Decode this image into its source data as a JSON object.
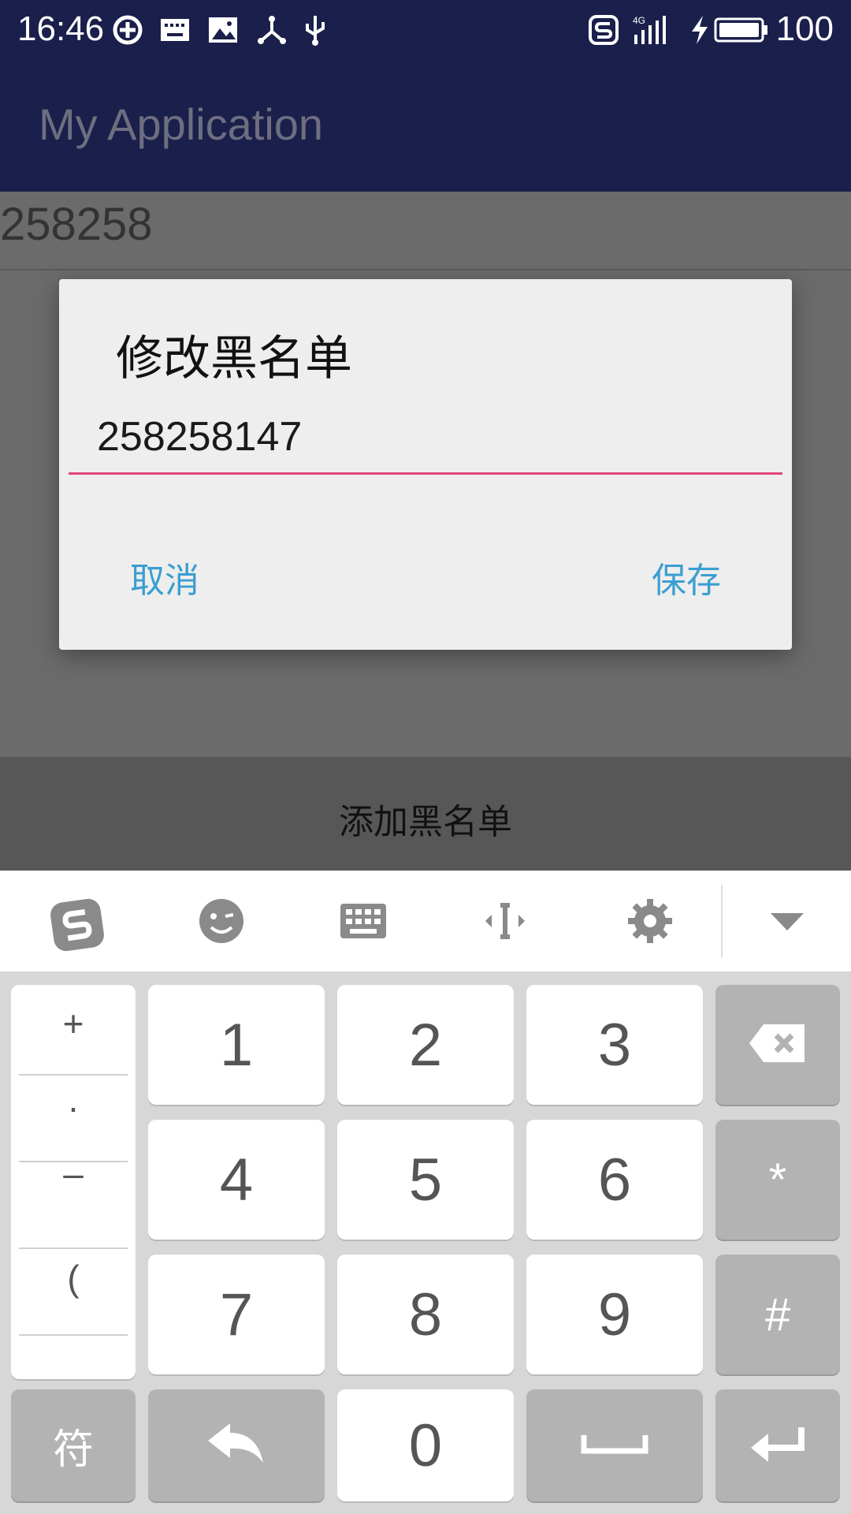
{
  "status_bar": {
    "time": "16:46",
    "battery_level": "100",
    "network": "4G",
    "icons": [
      "sync-icon",
      "keyboard-icon",
      "image-icon",
      "share-icon",
      "usb-icon",
      "sogou-icon",
      "signal-icon",
      "charging-icon",
      "battery-icon"
    ]
  },
  "app_bar": {
    "title": "My Application"
  },
  "list": {
    "items": [
      {
        "number": "258258"
      }
    ]
  },
  "bottom_button": {
    "label": "添加黑名单"
  },
  "dialog": {
    "title": "修改黑名单",
    "input_value": "258258147",
    "cancel_label": "取消",
    "save_label": "保存"
  },
  "keyboard": {
    "toolbar_icons": [
      "sogou-logo-icon",
      "emoji-icon",
      "keyboard-icon",
      "cursor-icon",
      "settings-icon",
      "collapse-icon"
    ],
    "symbols": [
      "+",
      ".",
      "–",
      "("
    ],
    "digits": [
      "1",
      "2",
      "3",
      "4",
      "5",
      "6",
      "7",
      "8",
      "9",
      "0"
    ],
    "star": "*",
    "hash": "#",
    "symbol_key": "符"
  },
  "colors": {
    "app_bar": "#1b1f4b",
    "accent_underline": "#e0457b",
    "dialog_buttons": "#3b9ed1",
    "dim_overlay": "#6b6b6b"
  }
}
